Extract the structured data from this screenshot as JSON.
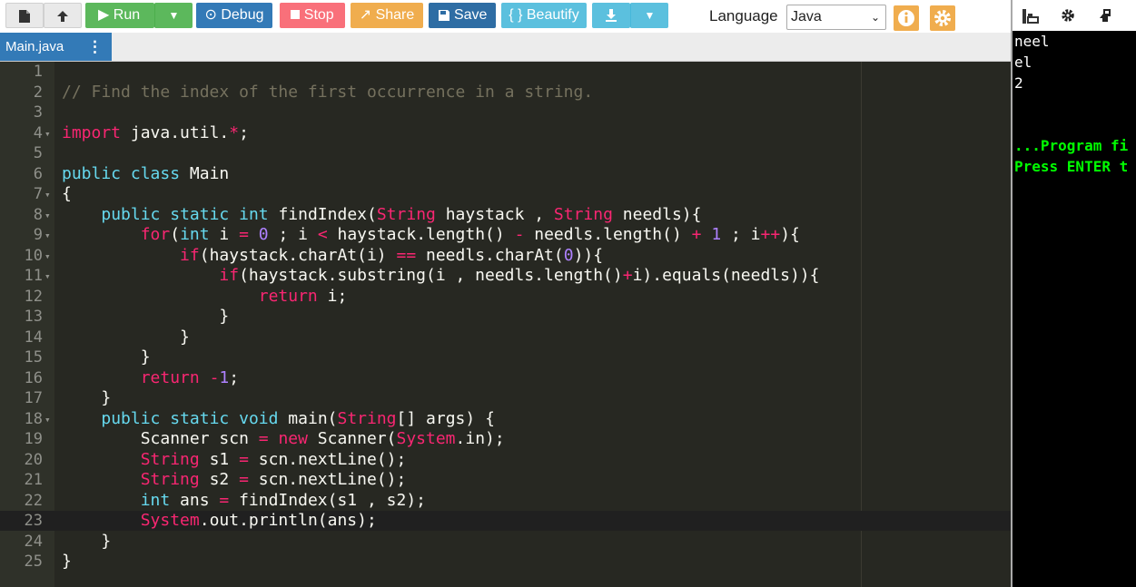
{
  "toolbar": {
    "run_label": "Run",
    "debug_label": "Debug",
    "stop_label": "Stop",
    "share_label": "Share",
    "save_label": "Save",
    "beautify_label": "{ } Beautify",
    "language_label": "Language",
    "language_value": "Java"
  },
  "tabs": [
    {
      "label": "Main.java"
    }
  ],
  "editor": {
    "active_line": 23,
    "lines": [
      {
        "n": "1",
        "html": ""
      },
      {
        "n": "2",
        "html": "<span class='c'>// Find the index of the first occurrence in a string.</span>"
      },
      {
        "n": "3",
        "html": ""
      },
      {
        "n": "4",
        "fold": true,
        "html": "<span class='k'>import</span> java.util.<span class='k'>*</span>;"
      },
      {
        "n": "5",
        "html": ""
      },
      {
        "n": "6",
        "html": "<span class='s'>public</span> <span class='s'>class</span> Main"
      },
      {
        "n": "7",
        "fold": true,
        "html": "{"
      },
      {
        "n": "8",
        "fold": true,
        "html": "    <span class='s'>public</span> <span class='s'>static</span> <span class='s'>int</span> findIndex(<span class='k'>String</span> haystack , <span class='k'>String</span> needls){"
      },
      {
        "n": "9",
        "fold": true,
        "html": "        <span class='k'>for</span>(<span class='s'>int</span> i <span class='k'>=</span> <span class='n'>0</span> ; i <span class='k'>&lt;</span> haystack.length() <span class='k'>-</span> needls.length() <span class='k'>+</span> <span class='n'>1</span> ; i<span class='k'>++</span>){"
      },
      {
        "n": "10",
        "fold": true,
        "html": "            <span class='k'>if</span>(haystack.charAt(i) <span class='k'>==</span> needls.charAt(<span class='n'>0</span>)){"
      },
      {
        "n": "11",
        "fold": true,
        "html": "                <span class='k'>if</span>(haystack.substring(i , needls.length()<span class='k'>+</span>i).equals(needls)){"
      },
      {
        "n": "12",
        "html": "                    <span class='k'>return</span> i;"
      },
      {
        "n": "13",
        "html": "                }"
      },
      {
        "n": "14",
        "html": "            }"
      },
      {
        "n": "15",
        "html": "        }"
      },
      {
        "n": "16",
        "html": "        <span class='k'>return</span> <span class='k'>-</span><span class='n'>1</span>;"
      },
      {
        "n": "17",
        "html": "    }"
      },
      {
        "n": "18",
        "fold": true,
        "html": "    <span class='s'>public</span> <span class='s'>static</span> <span class='s'>void</span> main(<span class='k'>String</span>[] args) {"
      },
      {
        "n": "19",
        "html": "        Scanner scn <span class='k'>=</span> <span class='k'>new</span> Scanner(<span class='k'>System</span>.in);"
      },
      {
        "n": "20",
        "html": "        <span class='k'>String</span> s1 <span class='k'>=</span> scn.nextLine();"
      },
      {
        "n": "21",
        "html": "        <span class='k'>String</span> s2 <span class='k'>=</span> scn.nextLine();"
      },
      {
        "n": "22",
        "html": "        <span class='s'>int</span> ans <span class='k'>=</span> findIndex(s1 , s2);"
      },
      {
        "n": "23",
        "html": "        <span class='k'>System</span>.out.println(ans);"
      },
      {
        "n": "24",
        "html": "    }"
      },
      {
        "n": "25",
        "html": "}"
      }
    ]
  },
  "console": {
    "lines": [
      {
        "text": "neel",
        "green": false
      },
      {
        "text": "el",
        "green": false
      },
      {
        "text": "2",
        "green": false
      },
      {
        "text": "",
        "green": false
      },
      {
        "text": "",
        "green": false
      },
      {
        "text": "...Program fi",
        "green": true
      },
      {
        "text": "Press ENTER t",
        "green": true
      }
    ]
  }
}
